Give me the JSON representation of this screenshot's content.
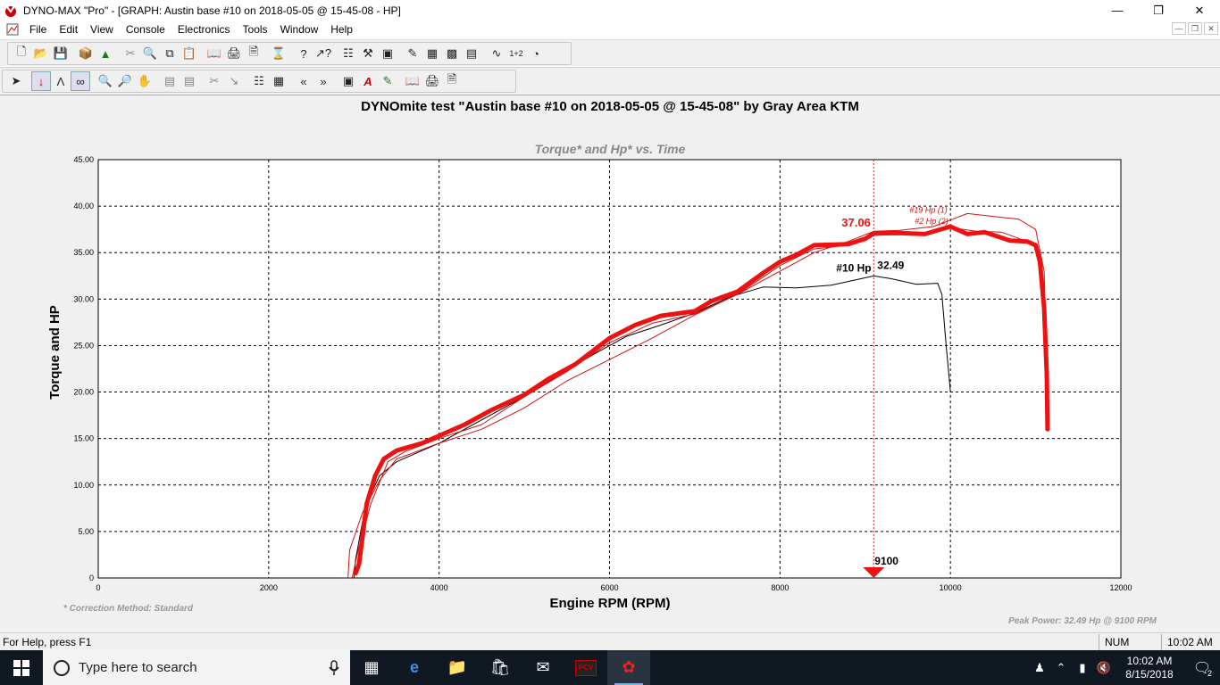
{
  "window": {
    "title": "DYNO-MAX \"Pro\" - [GRAPH: Austin base #10 on 2018-05-05 @ 15-45-08 - HP]"
  },
  "menu": {
    "items": [
      "File",
      "Edit",
      "View",
      "Console",
      "Electronics",
      "Tools",
      "Window",
      "Help"
    ]
  },
  "graph": {
    "main_title": "DYNOmite test \"Austin base #10 on 2018-05-05 @ 15-45-08\" by Gray Area KTM",
    "note_left": "* Correction Method: Standard",
    "note_right": "Peak Power: 32.49 Hp @ 9100 RPM"
  },
  "chart_data": {
    "type": "line",
    "title": "Torque* and Hp* vs. Time",
    "xlabel": "Engine RPM (RPM)",
    "ylabel": "Torque and HP",
    "xlim": [
      0,
      12000
    ],
    "ylim": [
      0,
      45
    ],
    "x_ticks": [
      "0",
      "2000",
      "4000",
      "6000",
      "8000",
      "10000",
      "12000"
    ],
    "y_ticks": [
      "0",
      "5.00",
      "10.00",
      "15.00",
      "20.00",
      "25.00",
      "30.00",
      "35.00",
      "40.00",
      "45.00"
    ],
    "grid": true,
    "cursor": {
      "x": 9100,
      "label": "9100"
    },
    "series": [
      {
        "name": "#10 Hp",
        "color": "#000000",
        "points": [
          [
            3000,
            0
          ],
          [
            3020,
            2
          ],
          [
            3100,
            6
          ],
          [
            3200,
            9
          ],
          [
            3300,
            11
          ],
          [
            3500,
            12.5
          ],
          [
            3800,
            13.7
          ],
          [
            4000,
            14.5
          ],
          [
            4300,
            16
          ],
          [
            4600,
            17.5
          ],
          [
            5000,
            19.5
          ],
          [
            5400,
            21.8
          ],
          [
            5800,
            24
          ],
          [
            6200,
            26
          ],
          [
            6600,
            27.2
          ],
          [
            7000,
            28.5
          ],
          [
            7400,
            30.2
          ],
          [
            7800,
            31.3
          ],
          [
            8200,
            31.2
          ],
          [
            8600,
            31.5
          ],
          [
            9100,
            32.49
          ],
          [
            9300,
            32.2
          ],
          [
            9600,
            31.6
          ],
          [
            9850,
            31.7
          ],
          [
            9900,
            30.5
          ],
          [
            9950,
            25
          ],
          [
            10000,
            20
          ]
        ]
      },
      {
        "name": "#19 Hp (1)",
        "color": "#d01010",
        "points": [
          [
            2930,
            0
          ],
          [
            2950,
            3
          ],
          [
            3100,
            7
          ],
          [
            3300,
            10.5
          ],
          [
            3500,
            12.8
          ],
          [
            4000,
            14.5
          ],
          [
            4500,
            16
          ],
          [
            5000,
            18.3
          ],
          [
            5500,
            21.2
          ],
          [
            6000,
            23.5
          ],
          [
            6500,
            25.8
          ],
          [
            7000,
            28.3
          ],
          [
            7500,
            30.5
          ],
          [
            8000,
            33
          ],
          [
            8400,
            35
          ],
          [
            8800,
            36.2
          ],
          [
            9100,
            37.3
          ],
          [
            9400,
            37.4
          ],
          [
            9800,
            37.8
          ],
          [
            10000,
            38.5
          ],
          [
            10200,
            39.2
          ],
          [
            10500,
            38.9
          ],
          [
            10800,
            38.6
          ],
          [
            11000,
            37.5
          ],
          [
            11100,
            33
          ],
          [
            11120,
            26
          ]
        ]
      },
      {
        "name": "#2 Hp (2)",
        "color": "#d01010",
        "points": [
          [
            2980,
            0
          ],
          [
            3050,
            3
          ],
          [
            3200,
            8
          ],
          [
            3400,
            12.5
          ],
          [
            3600,
            13.6
          ],
          [
            4000,
            15
          ],
          [
            4500,
            16.5
          ],
          [
            5000,
            19.5
          ],
          [
            5500,
            22.2
          ],
          [
            6000,
            25.3
          ],
          [
            6500,
            27.4
          ],
          [
            7000,
            28.4
          ],
          [
            7500,
            30.5
          ],
          [
            8000,
            33.6
          ],
          [
            8400,
            35.4
          ],
          [
            8800,
            35.8
          ],
          [
            9100,
            37
          ],
          [
            9400,
            37
          ],
          [
            9800,
            37.2
          ],
          [
            10000,
            37.7
          ],
          [
            10300,
            37.3
          ],
          [
            10600,
            37.2
          ],
          [
            10900,
            36.2
          ],
          [
            11000,
            35.8
          ],
          [
            11080,
            32
          ],
          [
            11120,
            24
          ],
          [
            11140,
            17
          ]
        ]
      },
      {
        "name": "",
        "color": "#ee1111",
        "bold": true,
        "points": [
          [
            3020,
            0.5
          ],
          [
            3060,
            1.5
          ],
          [
            3150,
            8
          ],
          [
            3250,
            11
          ],
          [
            3350,
            12.8
          ],
          [
            3500,
            13.7
          ],
          [
            3800,
            14.5
          ],
          [
            4000,
            15.3
          ],
          [
            4300,
            16.5
          ],
          [
            4600,
            18
          ],
          [
            5000,
            19.7
          ],
          [
            5300,
            21.5
          ],
          [
            5600,
            23
          ],
          [
            6000,
            25.8
          ],
          [
            6300,
            27.2
          ],
          [
            6600,
            28.2
          ],
          [
            7000,
            28.7
          ],
          [
            7200,
            29.8
          ],
          [
            7500,
            30.8
          ],
          [
            7800,
            32.8
          ],
          [
            8000,
            34
          ],
          [
            8200,
            34.8
          ],
          [
            8400,
            35.8
          ],
          [
            8800,
            35.9
          ],
          [
            9000,
            36.5
          ],
          [
            9100,
            37.06
          ],
          [
            9400,
            37.1
          ],
          [
            9700,
            37
          ],
          [
            10000,
            37.8
          ],
          [
            10200,
            37
          ],
          [
            10400,
            37.2
          ],
          [
            10700,
            36.3
          ],
          [
            10900,
            36.2
          ],
          [
            11000,
            35.8
          ],
          [
            11050,
            34
          ],
          [
            11100,
            29
          ],
          [
            11130,
            22
          ],
          [
            11140,
            16
          ]
        ]
      }
    ],
    "labels": [
      {
        "text": "37.06",
        "x": 9100,
        "y": 37.06,
        "color": "#ee1111"
      },
      {
        "text": "#10 Hp",
        "x": 9100,
        "y": 32.49,
        "color": "#000000"
      },
      {
        "text": "32.49",
        "x": 9100,
        "y": 32.49,
        "color": "#000000"
      },
      {
        "text": "#19 Hp (1)",
        "x": 9100,
        "y": 39.2,
        "color": "#d01010"
      },
      {
        "text": "#2 Hp (2)",
        "x": 9100,
        "y": 38,
        "color": "#d01010"
      }
    ]
  },
  "status": {
    "help": "For Help, press F1",
    "num": "NUM",
    "time": "10:02 AM"
  },
  "taskbar": {
    "search_placeholder": "Type here to search",
    "clock_time": "10:02 AM",
    "clock_date": "8/15/2018",
    "notification_count": "2"
  },
  "colors": {
    "taskbar_bg": "#101822",
    "chart_bg": "#ffffff",
    "chart_area_bg": "#f0f0f0"
  }
}
